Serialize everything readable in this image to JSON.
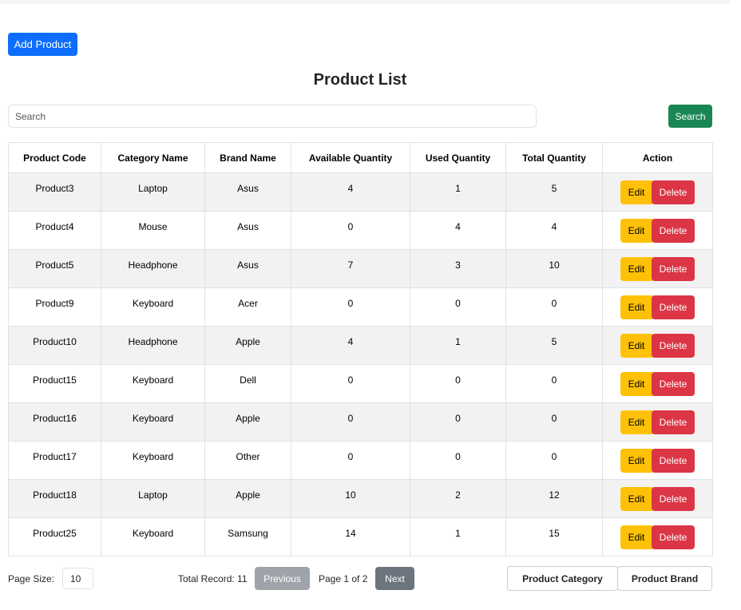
{
  "header": {
    "add_product_label": "Add Product",
    "title": "Product List"
  },
  "search": {
    "placeholder": "Search",
    "value": "",
    "button_label": "Search"
  },
  "table": {
    "columns": [
      "Product Code",
      "Category Name",
      "Brand Name",
      "Available Quantity",
      "Used Quantity",
      "Total Quantity",
      "Action"
    ],
    "rows": [
      {
        "code": "Product3",
        "category": "Laptop",
        "brand": "Asus",
        "available": "4",
        "used": "1",
        "total": "5"
      },
      {
        "code": "Product4",
        "category": "Mouse",
        "brand": "Asus",
        "available": "0",
        "used": "4",
        "total": "4"
      },
      {
        "code": "Product5",
        "category": "Headphone",
        "brand": "Asus",
        "available": "7",
        "used": "3",
        "total": "10"
      },
      {
        "code": "Product9",
        "category": "Keyboard",
        "brand": "Acer",
        "available": "0",
        "used": "0",
        "total": "0"
      },
      {
        "code": "Product10",
        "category": "Headphone",
        "brand": "Apple",
        "available": "4",
        "used": "1",
        "total": "5"
      },
      {
        "code": "Product15",
        "category": "Keyboard",
        "brand": "Dell",
        "available": "0",
        "used": "0",
        "total": "0"
      },
      {
        "code": "Product16",
        "category": "Keyboard",
        "brand": "Apple",
        "available": "0",
        "used": "0",
        "total": "0"
      },
      {
        "code": "Product17",
        "category": "Keyboard",
        "brand": "Other",
        "available": "0",
        "used": "0",
        "total": "0"
      },
      {
        "code": "Product18",
        "category": "Laptop",
        "brand": "Apple",
        "available": "10",
        "used": "2",
        "total": "12"
      },
      {
        "code": "Product25",
        "category": "Keyboard",
        "brand": "Samsung",
        "available": "14",
        "used": "1",
        "total": "15"
      }
    ],
    "edit_label": "Edit",
    "delete_label": "Delete"
  },
  "footer": {
    "page_size_label": "Page Size:",
    "page_size_value": "10",
    "total_record": "Total Record: 11",
    "previous_label": "Previous",
    "page_info": "Page 1 of 2",
    "next_label": "Next",
    "product_category_label": "Product Category",
    "product_brand_label": "Product Brand"
  },
  "colors": {
    "primary": "#0d6efd",
    "success": "#198754",
    "warning": "#ffc107",
    "danger": "#dc3545",
    "secondary": "#6c757d"
  }
}
